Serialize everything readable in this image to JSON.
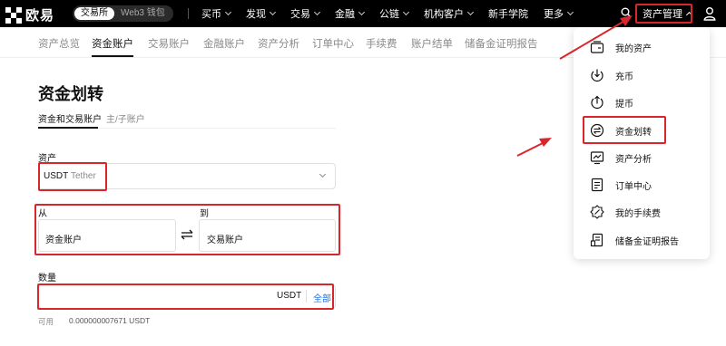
{
  "brand": {
    "name": "欧易"
  },
  "mode_switch": {
    "exchange": "交易所",
    "web3": "Web3 钱包"
  },
  "nav": {
    "items": [
      {
        "label": "买币",
        "dropdown": true
      },
      {
        "label": "发现",
        "dropdown": true
      },
      {
        "label": "交易",
        "dropdown": true
      },
      {
        "label": "金融",
        "dropdown": true
      },
      {
        "label": "公链",
        "dropdown": true
      },
      {
        "label": "机构客户",
        "dropdown": true
      },
      {
        "label": "新手学院",
        "dropdown": false
      },
      {
        "label": "更多",
        "dropdown": true
      }
    ],
    "asset_management": "资产管理"
  },
  "subnav": {
    "items": [
      "资产总览",
      "资金账户",
      "交易账户",
      "金融账户",
      "资产分析",
      "订单中心",
      "手续费",
      "账户结单",
      "储备金证明报告"
    ],
    "active": "资金账户"
  },
  "page": {
    "title": "资金划转",
    "tabs": [
      "资金和交易账户",
      "主/子账户"
    ],
    "asset_label": "资产",
    "asset_code": "USDT",
    "asset_name": "Tether",
    "from_label": "从",
    "to_label": "到",
    "from_account": "资金账户",
    "to_account": "交易账户",
    "quantity_label": "数量",
    "quantity_unit": "USDT",
    "all_label": "全部",
    "available_label": "可用",
    "available_value": "0.000000007671 USDT"
  },
  "dropdown": {
    "items": [
      {
        "label": "我的资产",
        "icon": "wallet-icon"
      },
      {
        "label": "充币",
        "icon": "deposit-icon"
      },
      {
        "label": "提币",
        "icon": "withdraw-icon"
      },
      {
        "label": "资金划转",
        "icon": "transfer-icon"
      },
      {
        "label": "资产分析",
        "icon": "analysis-icon"
      },
      {
        "label": "订单中心",
        "icon": "order-icon"
      },
      {
        "label": "我的手续费",
        "icon": "fee-icon"
      },
      {
        "label": "储备金证明报告",
        "icon": "report-icon"
      }
    ]
  },
  "colors": {
    "highlight": "#d9262c",
    "link": "#1a73e8",
    "topbar": "#000000"
  }
}
